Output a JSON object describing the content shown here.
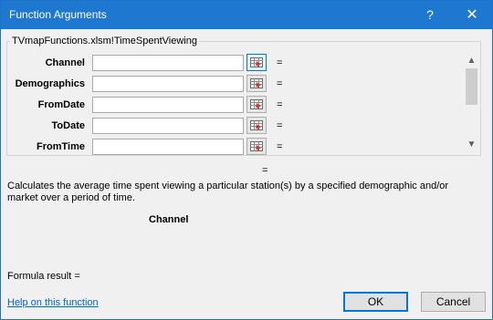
{
  "window": {
    "title": "Function Arguments",
    "help_glyph": "?",
    "close_glyph": "✕"
  },
  "function": {
    "group_title": "TVmapFunctions.xlsm!TimeSpentViewing",
    "arguments": [
      {
        "label": "Channel",
        "value": "",
        "equals": "="
      },
      {
        "label": "Demographics",
        "value": "",
        "equals": "="
      },
      {
        "label": "FromDate",
        "value": "",
        "equals": "="
      },
      {
        "label": "ToDate",
        "value": "",
        "equals": "="
      },
      {
        "label": "FromTime",
        "value": "",
        "equals": "="
      }
    ],
    "result_equals": "=",
    "description": "Calculates the average time spent viewing a particular station(s) by a specified demographic and/or market over a period of time.",
    "current_argument": "Channel"
  },
  "footer": {
    "formula_result": "Formula result =",
    "help_link": "Help on this function",
    "ok_label": "OK",
    "cancel_label": "Cancel"
  },
  "icons": {
    "help": "help-icon",
    "close": "close-icon",
    "ref": "collapse-dialog-icon",
    "scroll_up": "scroll-up-icon",
    "scroll_down": "scroll-down-icon"
  },
  "colors": {
    "titlebar": "#1f78d0",
    "accent": "#0078d7",
    "link": "#0066cc",
    "window_bg": "#f0f0f0"
  }
}
